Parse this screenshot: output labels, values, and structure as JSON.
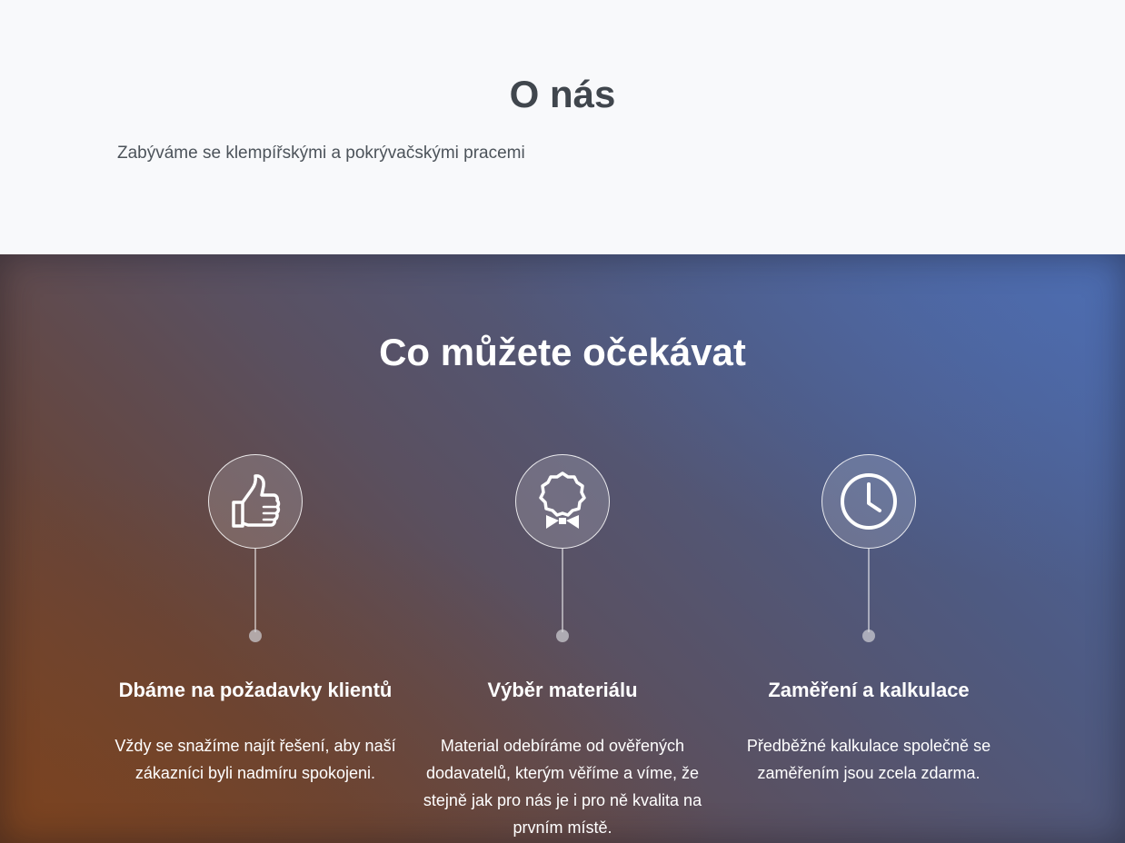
{
  "about": {
    "title": "O nás",
    "text": "Zabýváme se klempířskými a pokrývačskými pracemi"
  },
  "features": {
    "title": "Co můžete očekávat",
    "items": [
      {
        "icon": "thumbs-up-icon",
        "title": "Dbáme na požadavky klientů",
        "text": "Vždy se snažíme najít řešení, aby naší zákazníci byli nadmíru spokojeni."
      },
      {
        "icon": "award-ribbon-icon",
        "title": "Výběr materiálu",
        "text": "Material odebíráme od ověřených dodavatelů, kterým věříme a víme, že stejně jak pro nás je i pro ně kvalita na prvním místě."
      },
      {
        "icon": "clock-icon",
        "title": "Zaměření a kalkulace",
        "text": "Předběžné kalkulace společně se zaměřením jsou zcela zdarma."
      }
    ]
  }
}
